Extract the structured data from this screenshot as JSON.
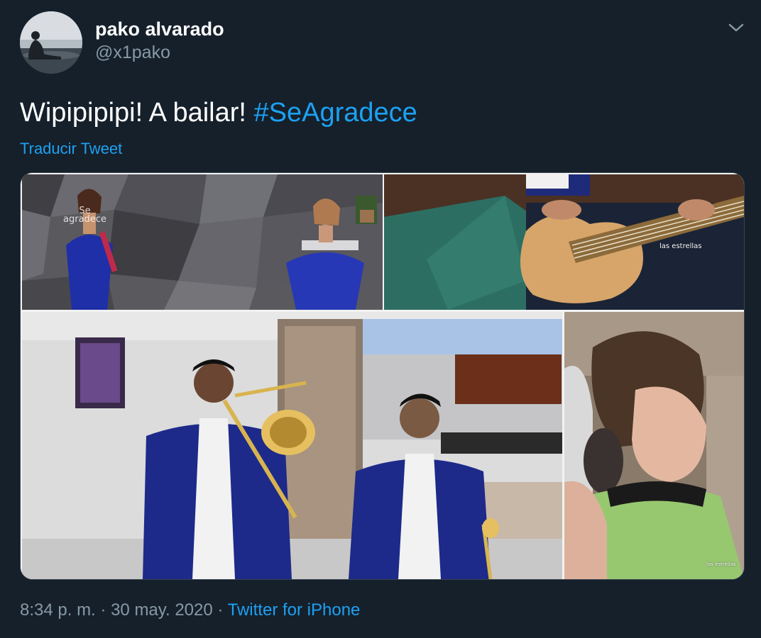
{
  "author": {
    "display_name": "pako alvarado",
    "handle": "@x1pako",
    "avatar_icon": "avatar-photo"
  },
  "menu": {
    "icon": "chevron-down-icon"
  },
  "tweet": {
    "text_before": "Wipipipipi! A bailar! ",
    "hashtag": "#SeAgradece",
    "translate_label": "Traducir Tweet"
  },
  "media": {
    "watermark_line1": "Se",
    "watermark_line2": "agradece",
    "channel_label": "las estrellas",
    "channel_label_small": "las estrellas"
  },
  "footer": {
    "time": "8:34 p. m.",
    "separator": "·",
    "date": "30 may. 2020",
    "source": "Twitter for iPhone"
  },
  "colors": {
    "background": "#15202b",
    "link": "#1da1f2",
    "secondary_text": "#8899a6",
    "border": "#38444d"
  }
}
